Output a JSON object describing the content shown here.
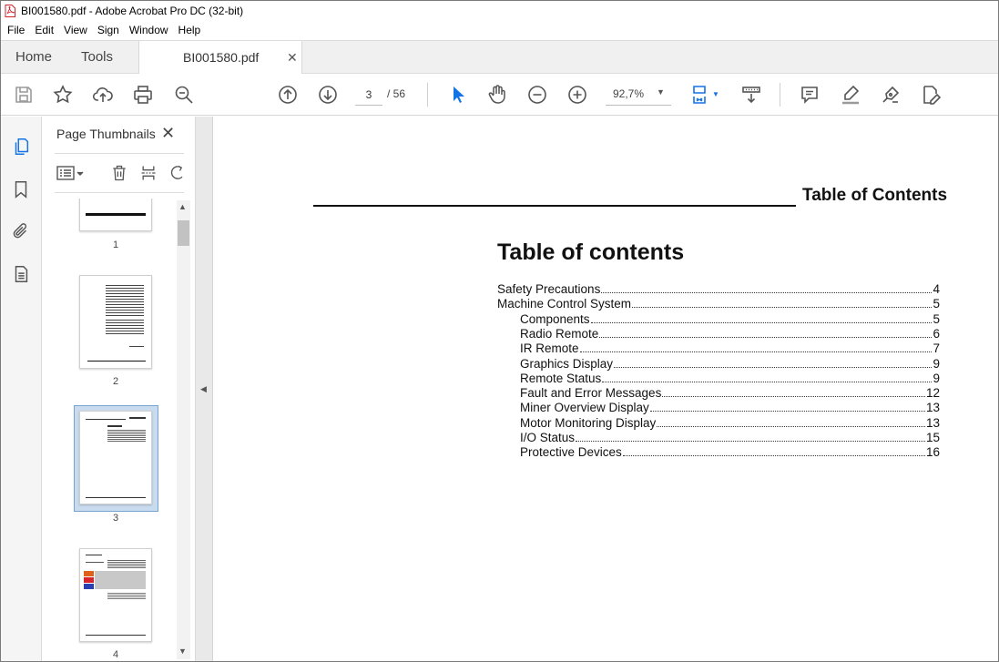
{
  "window": {
    "title": "BI001580.pdf - Adobe Acrobat Pro DC (32-bit)"
  },
  "menu": [
    "File",
    "Edit",
    "View",
    "Sign",
    "Window",
    "Help"
  ],
  "tabs": {
    "home": "Home",
    "tools": "Tools",
    "document": "BI001580.pdf",
    "close_glyph": "✕"
  },
  "toolbar": {
    "current_page": "3",
    "total_pages": "/  56",
    "zoom": "92,7%",
    "icons": [
      "save-icon",
      "star-icon",
      "upload-icon",
      "print-icon",
      "search-icon",
      "page-up-icon",
      "page-down-icon",
      "select-cursor-icon",
      "hand-icon",
      "zoom-out-icon",
      "zoom-in-icon",
      "fit-page-icon",
      "scroll-mode-icon",
      "comment-icon",
      "highlight-icon",
      "sign-icon",
      "edit-pdf-icon"
    ]
  },
  "panel": {
    "title": "Page Thumbnails",
    "close_glyph": "✕",
    "thumbnails": [
      {
        "number": "1"
      },
      {
        "number": "2"
      },
      {
        "number": "3",
        "selected": true
      },
      {
        "number": "4"
      }
    ]
  },
  "document": {
    "header_title": "Table of Contents",
    "heading": "Table of contents",
    "toc": [
      {
        "title": "Safety Precautions",
        "page": "4",
        "level": 1
      },
      {
        "title": "Machine Control System",
        "page": "5",
        "level": 1
      },
      {
        "title": "Components",
        "page": "5",
        "level": 2
      },
      {
        "title": "Radio Remote",
        "page": "6",
        "level": 2
      },
      {
        "title": "IR Remote",
        "page": "7",
        "level": 2
      },
      {
        "title": "Graphics Display",
        "page": "9",
        "level": 2
      },
      {
        "title": "Remote Status",
        "page": "9",
        "level": 2
      },
      {
        "title": "Fault and Error Messages",
        "page": "12",
        "level": 2
      },
      {
        "title": "Miner Overview Display",
        "page": "13",
        "level": 2
      },
      {
        "title": "Motor Monitoring Display",
        "page": "13",
        "level": 2
      },
      {
        "title": "I/O Status",
        "page": "15",
        "level": 2
      },
      {
        "title": "Protective Devices",
        "page": "16",
        "level": 2
      }
    ]
  },
  "colors": {
    "accent": "#1473e6",
    "selected_thumb": "#c9dbee",
    "icon_gray": "#555555"
  }
}
